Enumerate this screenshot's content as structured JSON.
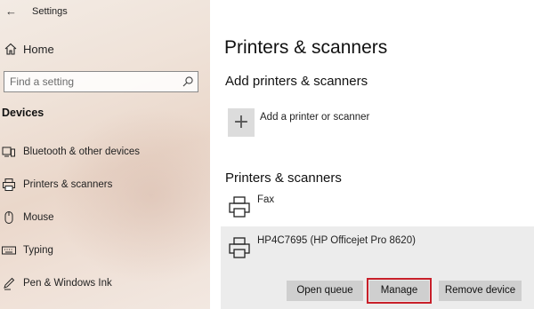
{
  "window": {
    "title": "Settings"
  },
  "sidebar": {
    "home_label": "Home",
    "search_placeholder": "Find a setting",
    "section_header": "Devices",
    "items": [
      {
        "label": "Bluetooth & other devices",
        "icon": "bluetooth-devices-icon"
      },
      {
        "label": "Printers & scanners",
        "icon": "printer-icon"
      },
      {
        "label": "Mouse",
        "icon": "mouse-icon"
      },
      {
        "label": "Typing",
        "icon": "keyboard-icon"
      },
      {
        "label": "Pen & Windows Ink",
        "icon": "pen-icon"
      }
    ]
  },
  "main": {
    "title": "Printers & scanners",
    "add_section": {
      "heading": "Add printers & scanners",
      "add_label": "Add a printer or scanner"
    },
    "list_section": {
      "heading": "Printers & scanners",
      "printers": [
        {
          "name": "Fax"
        },
        {
          "name": "HP4C7695 (HP Officejet Pro 8620)"
        }
      ]
    },
    "buttons": {
      "open_queue": "Open queue",
      "manage": "Manage",
      "remove_device": "Remove device"
    },
    "highlight_color": "#c8202a"
  }
}
